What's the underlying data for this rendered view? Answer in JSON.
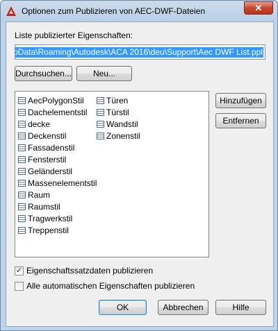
{
  "window": {
    "title": "Optionen zum Publizieren von AEC-DWF-Dateien",
    "close_glyph": "✕"
  },
  "list_label": "Liste publizierter Eigenschaften:",
  "path_value": "or\\AppData\\Roaming\\Autodesk\\ACA 2016\\deu\\Support\\Aec DWF List.ppl",
  "buttons": {
    "browse": "Durchsuchen...",
    "new": "Neu...",
    "add": "Hinzufügen",
    "remove": "Entfernen",
    "ok": "OK",
    "cancel": "Abbrechen",
    "help": "Hilfe"
  },
  "property_sets": {
    "column1": [
      "AecPolygonStil",
      "Dachelementstil",
      "decke",
      "Deckenstil",
      "Fassadenstil",
      "Fensterstil",
      "Geländerstil",
      "Massenelementstil",
      "Raum",
      "Raumstil",
      "Tragwerkstil",
      "Treppenstil"
    ],
    "column2": [
      "Türen",
      "Türstil",
      "Wandstil",
      "Zonenstil"
    ]
  },
  "options": {
    "publish_property_set_data": {
      "label": "Eigenschaftssatzdaten publizieren",
      "checked": true,
      "mark": "✓"
    },
    "publish_automatic_properties": {
      "label": "Alle automatischen Eigenschaften publizieren",
      "checked": false,
      "mark": ""
    }
  },
  "icons": {
    "app": "autocad-app-icon",
    "item": "property-set-icon"
  }
}
